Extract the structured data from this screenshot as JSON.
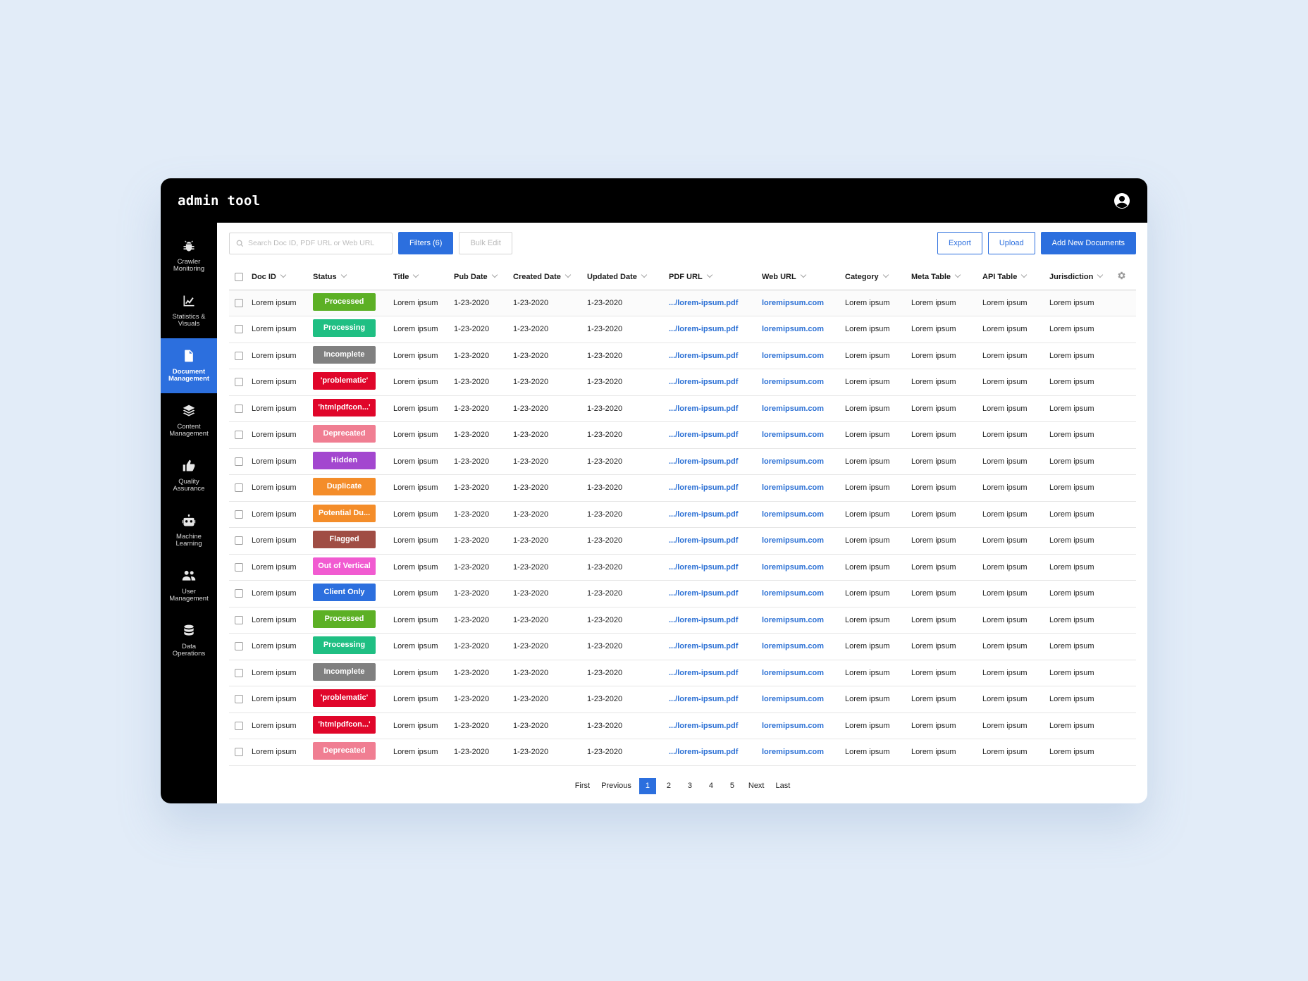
{
  "app": {
    "title": "admin tool"
  },
  "sidebar": {
    "items": [
      {
        "label": "Crawler\nMonitoring",
        "icon": "bug-icon",
        "active": false
      },
      {
        "label": "Statistics &\nVisuals",
        "icon": "chart-icon",
        "active": false
      },
      {
        "label": "Document\nManagement",
        "icon": "document-icon",
        "active": true
      },
      {
        "label": "Content\nManagement",
        "icon": "layers-icon",
        "active": false
      },
      {
        "label": "Quality\nAssurance",
        "icon": "thumbs-up-icon",
        "active": false
      },
      {
        "label": "Machine\nLearning",
        "icon": "robot-icon",
        "active": false
      },
      {
        "label": "User\nManagement",
        "icon": "users-icon",
        "active": false
      },
      {
        "label": "Data\nOperations",
        "icon": "database-icon",
        "active": false
      }
    ]
  },
  "toolbar": {
    "search_placeholder": "Search Doc ID, PDF URL or Web URL",
    "filters_label": "Filters (6)",
    "bulk_edit_label": "Bulk Edit",
    "export_label": "Export",
    "upload_label": "Upload",
    "add_label": "Add New Documents"
  },
  "table": {
    "columns": [
      "Doc ID",
      "Status",
      "Title",
      "Pub Date",
      "Created Date",
      "Updated Date",
      "PDF URL",
      "Web URL",
      "Category",
      "Meta Table",
      "API Table",
      "Jurisdiction"
    ],
    "status_colors": {
      "Processed": "#5cb025",
      "Processing": "#1fbf83",
      "Incomplete": "#808080",
      "'problematic'": "#e0062a",
      "'htmlpdfcon...'": "#e0062a",
      "Deprecated": "#f07e92",
      "Hidden": "#a347cf",
      "Duplicate": "#f48d2a",
      "Potential Du...": "#f48d2a",
      "Flagged": "#a04d44",
      "Out of Vertical": "#f15bd1",
      "Client Only": "#2c6fde"
    },
    "rows": [
      {
        "doc_id": "Lorem ipsum",
        "status": "Processed",
        "title": "Lorem ipsum",
        "pub_date": "1-23-2020",
        "created": "1-23-2020",
        "updated": "1-23-2020",
        "pdf_url": ".../lorem-ipsum.pdf",
        "web_url": "loremipsum.com",
        "category": "Lorem ipsum",
        "meta": "Lorem ipsum",
        "api": "Lorem ipsum",
        "jurisdiction": "Lorem ipsum"
      },
      {
        "doc_id": "Lorem ipsum",
        "status": "Processing",
        "title": "Lorem ipsum",
        "pub_date": "1-23-2020",
        "created": "1-23-2020",
        "updated": "1-23-2020",
        "pdf_url": ".../lorem-ipsum.pdf",
        "web_url": "loremipsum.com",
        "category": "Lorem ipsum",
        "meta": "Lorem ipsum",
        "api": "Lorem ipsum",
        "jurisdiction": "Lorem ipsum"
      },
      {
        "doc_id": "Lorem ipsum",
        "status": "Incomplete",
        "title": "Lorem ipsum",
        "pub_date": "1-23-2020",
        "created": "1-23-2020",
        "updated": "1-23-2020",
        "pdf_url": ".../lorem-ipsum.pdf",
        "web_url": "loremipsum.com",
        "category": "Lorem ipsum",
        "meta": "Lorem ipsum",
        "api": "Lorem ipsum",
        "jurisdiction": "Lorem ipsum"
      },
      {
        "doc_id": "Lorem ipsum",
        "status": "'problematic'",
        "title": "Lorem ipsum",
        "pub_date": "1-23-2020",
        "created": "1-23-2020",
        "updated": "1-23-2020",
        "pdf_url": ".../lorem-ipsum.pdf",
        "web_url": "loremipsum.com",
        "category": "Lorem ipsum",
        "meta": "Lorem ipsum",
        "api": "Lorem ipsum",
        "jurisdiction": "Lorem ipsum"
      },
      {
        "doc_id": "Lorem ipsum",
        "status": "'htmlpdfcon...'",
        "title": "Lorem ipsum",
        "pub_date": "1-23-2020",
        "created": "1-23-2020",
        "updated": "1-23-2020",
        "pdf_url": ".../lorem-ipsum.pdf",
        "web_url": "loremipsum.com",
        "category": "Lorem ipsum",
        "meta": "Lorem ipsum",
        "api": "Lorem ipsum",
        "jurisdiction": "Lorem ipsum"
      },
      {
        "doc_id": "Lorem ipsum",
        "status": "Deprecated",
        "title": "Lorem ipsum",
        "pub_date": "1-23-2020",
        "created": "1-23-2020",
        "updated": "1-23-2020",
        "pdf_url": ".../lorem-ipsum.pdf",
        "web_url": "loremipsum.com",
        "category": "Lorem ipsum",
        "meta": "Lorem ipsum",
        "api": "Lorem ipsum",
        "jurisdiction": "Lorem ipsum"
      },
      {
        "doc_id": "Lorem ipsum",
        "status": "Hidden",
        "title": "Lorem ipsum",
        "pub_date": "1-23-2020",
        "created": "1-23-2020",
        "updated": "1-23-2020",
        "pdf_url": ".../lorem-ipsum.pdf",
        "web_url": "loremipsum.com",
        "category": "Lorem ipsum",
        "meta": "Lorem ipsum",
        "api": "Lorem ipsum",
        "jurisdiction": "Lorem ipsum"
      },
      {
        "doc_id": "Lorem ipsum",
        "status": "Duplicate",
        "title": "Lorem ipsum",
        "pub_date": "1-23-2020",
        "created": "1-23-2020",
        "updated": "1-23-2020",
        "pdf_url": ".../lorem-ipsum.pdf",
        "web_url": "loremipsum.com",
        "category": "Lorem ipsum",
        "meta": "Lorem ipsum",
        "api": "Lorem ipsum",
        "jurisdiction": "Lorem ipsum"
      },
      {
        "doc_id": "Lorem ipsum",
        "status": "Potential Du...",
        "title": "Lorem ipsum",
        "pub_date": "1-23-2020",
        "created": "1-23-2020",
        "updated": "1-23-2020",
        "pdf_url": ".../lorem-ipsum.pdf",
        "web_url": "loremipsum.com",
        "category": "Lorem ipsum",
        "meta": "Lorem ipsum",
        "api": "Lorem ipsum",
        "jurisdiction": "Lorem ipsum"
      },
      {
        "doc_id": "Lorem ipsum",
        "status": "Flagged",
        "title": "Lorem ipsum",
        "pub_date": "1-23-2020",
        "created": "1-23-2020",
        "updated": "1-23-2020",
        "pdf_url": ".../lorem-ipsum.pdf",
        "web_url": "loremipsum.com",
        "category": "Lorem ipsum",
        "meta": "Lorem ipsum",
        "api": "Lorem ipsum",
        "jurisdiction": "Lorem ipsum"
      },
      {
        "doc_id": "Lorem ipsum",
        "status": "Out of Vertical",
        "title": "Lorem ipsum",
        "pub_date": "1-23-2020",
        "created": "1-23-2020",
        "updated": "1-23-2020",
        "pdf_url": ".../lorem-ipsum.pdf",
        "web_url": "loremipsum.com",
        "category": "Lorem ipsum",
        "meta": "Lorem ipsum",
        "api": "Lorem ipsum",
        "jurisdiction": "Lorem ipsum"
      },
      {
        "doc_id": "Lorem ipsum",
        "status": "Client Only",
        "title": "Lorem ipsum",
        "pub_date": "1-23-2020",
        "created": "1-23-2020",
        "updated": "1-23-2020",
        "pdf_url": ".../lorem-ipsum.pdf",
        "web_url": "loremipsum.com",
        "category": "Lorem ipsum",
        "meta": "Lorem ipsum",
        "api": "Lorem ipsum",
        "jurisdiction": "Lorem ipsum"
      },
      {
        "doc_id": "Lorem ipsum",
        "status": "Processed",
        "title": "Lorem ipsum",
        "pub_date": "1-23-2020",
        "created": "1-23-2020",
        "updated": "1-23-2020",
        "pdf_url": ".../lorem-ipsum.pdf",
        "web_url": "loremipsum.com",
        "category": "Lorem ipsum",
        "meta": "Lorem ipsum",
        "api": "Lorem ipsum",
        "jurisdiction": "Lorem ipsum"
      },
      {
        "doc_id": "Lorem ipsum",
        "status": "Processing",
        "title": "Lorem ipsum",
        "pub_date": "1-23-2020",
        "created": "1-23-2020",
        "updated": "1-23-2020",
        "pdf_url": ".../lorem-ipsum.pdf",
        "web_url": "loremipsum.com",
        "category": "Lorem ipsum",
        "meta": "Lorem ipsum",
        "api": "Lorem ipsum",
        "jurisdiction": "Lorem ipsum"
      },
      {
        "doc_id": "Lorem ipsum",
        "status": "Incomplete",
        "title": "Lorem ipsum",
        "pub_date": "1-23-2020",
        "created": "1-23-2020",
        "updated": "1-23-2020",
        "pdf_url": ".../lorem-ipsum.pdf",
        "web_url": "loremipsum.com",
        "category": "Lorem ipsum",
        "meta": "Lorem ipsum",
        "api": "Lorem ipsum",
        "jurisdiction": "Lorem ipsum"
      },
      {
        "doc_id": "Lorem ipsum",
        "status": "'problematic'",
        "title": "Lorem ipsum",
        "pub_date": "1-23-2020",
        "created": "1-23-2020",
        "updated": "1-23-2020",
        "pdf_url": ".../lorem-ipsum.pdf",
        "web_url": "loremipsum.com",
        "category": "Lorem ipsum",
        "meta": "Lorem ipsum",
        "api": "Lorem ipsum",
        "jurisdiction": "Lorem ipsum"
      },
      {
        "doc_id": "Lorem ipsum",
        "status": "'htmlpdfcon...'",
        "title": "Lorem ipsum",
        "pub_date": "1-23-2020",
        "created": "1-23-2020",
        "updated": "1-23-2020",
        "pdf_url": ".../lorem-ipsum.pdf",
        "web_url": "loremipsum.com",
        "category": "Lorem ipsum",
        "meta": "Lorem ipsum",
        "api": "Lorem ipsum",
        "jurisdiction": "Lorem ipsum"
      },
      {
        "doc_id": "Lorem ipsum",
        "status": "Deprecated",
        "title": "Lorem ipsum",
        "pub_date": "1-23-2020",
        "created": "1-23-2020",
        "updated": "1-23-2020",
        "pdf_url": ".../lorem-ipsum.pdf",
        "web_url": "loremipsum.com",
        "category": "Lorem ipsum",
        "meta": "Lorem ipsum",
        "api": "Lorem ipsum",
        "jurisdiction": "Lorem ipsum"
      }
    ]
  },
  "pagination": {
    "first": "First",
    "previous": "Previous",
    "pages": [
      "1",
      "2",
      "3",
      "4",
      "5"
    ],
    "current": "1",
    "next": "Next",
    "last": "Last"
  }
}
